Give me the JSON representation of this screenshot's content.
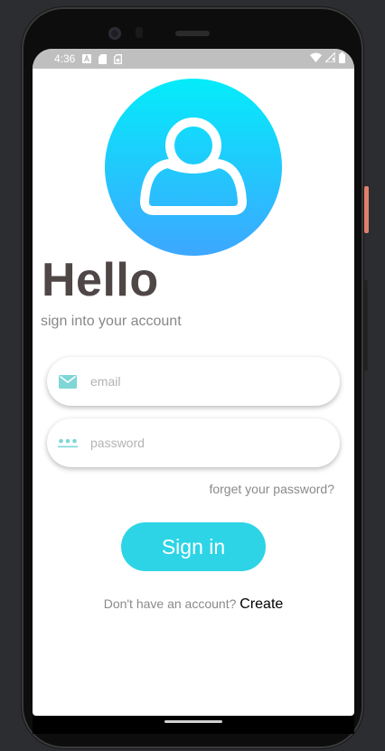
{
  "status_bar": {
    "time": "4:36",
    "left_icons": [
      "a-notification-icon",
      "sd-card-icon",
      "sim-icon"
    ],
    "right_icons": [
      "wifi-icon",
      "signal-icon",
      "battery-icon"
    ]
  },
  "login": {
    "avatar_icon": "user-icon",
    "title": "Hello",
    "subtitle": "sign into your account",
    "email_placeholder": "email",
    "email_icon": "mail-icon",
    "password_placeholder": "password",
    "password_icon": "password-dots-icon",
    "forgot_label": "forget your password?",
    "signin_label": "Sign in",
    "no_account_text": "Don't have an account?",
    "create_label": "Create"
  },
  "colors": {
    "accent": "#2dd4e6",
    "avatar_top": "#04ecfa",
    "avatar_bottom": "#3da7ff",
    "title": "#4f4646",
    "field_icon": "#7fd6d6"
  }
}
